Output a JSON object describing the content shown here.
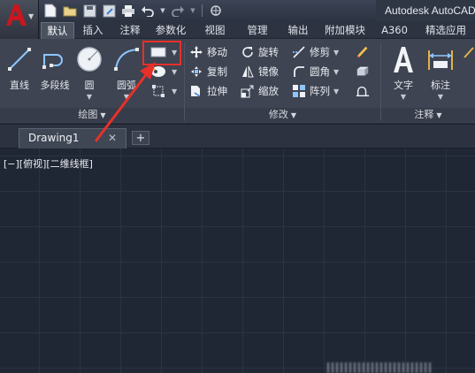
{
  "window": {
    "title": "Autodesk AutoCAD"
  },
  "quick_access": [
    "new-icon",
    "open-icon",
    "save-icon",
    "save-as-icon",
    "print-icon",
    "undo-icon",
    "redo-icon",
    "share-icon"
  ],
  "tabs": [
    {
      "label": "默认",
      "active": true
    },
    {
      "label": "插入"
    },
    {
      "label": "注释"
    },
    {
      "label": "参数化"
    },
    {
      "label": "视图"
    },
    {
      "label": "管理"
    },
    {
      "label": "输出"
    },
    {
      "label": "附加模块"
    },
    {
      "label": "A360"
    },
    {
      "label": "精选应用"
    }
  ],
  "draw_panel": {
    "title": "绘图",
    "tools": [
      {
        "label": "直线"
      },
      {
        "label": "多段线"
      },
      {
        "label": "圆"
      },
      {
        "label": "圆弧"
      }
    ]
  },
  "modify_panel": {
    "title": "修改",
    "tools": [
      {
        "label": "移动"
      },
      {
        "label": "旋转"
      },
      {
        "label": "修剪"
      },
      {
        "label": "复制"
      },
      {
        "label": "镜像"
      },
      {
        "label": "圆角"
      },
      {
        "label": "拉伸"
      },
      {
        "label": "缩放"
      },
      {
        "label": "阵列"
      }
    ]
  },
  "annotation_panel": {
    "title": "注释",
    "tools": [
      {
        "label": "文字"
      },
      {
        "label": "标注"
      }
    ]
  },
  "file_tabs": {
    "drawing": "Drawing1",
    "close": "✕",
    "add": "+"
  },
  "viewport": {
    "label": "[−][俯视][二维线框]"
  },
  "colors": {
    "highlight": "#e8302a",
    "app_red": "#c8171e",
    "canvas": "#202734"
  }
}
